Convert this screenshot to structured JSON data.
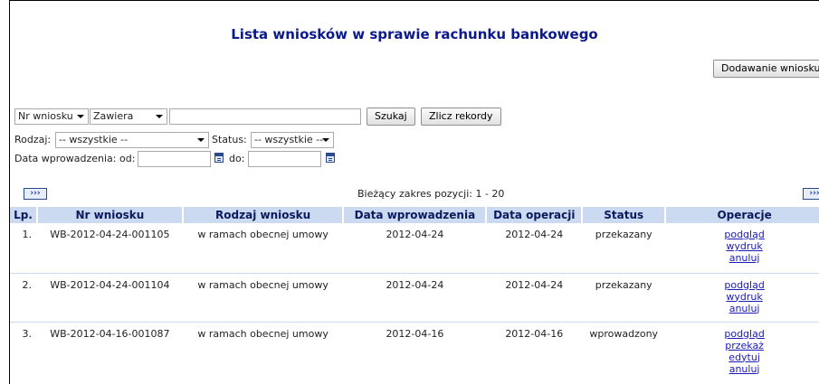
{
  "page": {
    "title": "Lista wniosków w sprawie rachunku bankowego",
    "add_button": "Dodawanie wniosku"
  },
  "filters": {
    "field_select": "Nr wniosku",
    "operator_select": "Zawiera",
    "search_value": "",
    "search_button": "Szukaj",
    "count_button": "Zlicz rekordy",
    "type_label": "Rodzaj:",
    "type_select": "-- wszystkie --",
    "status_label": "Status:",
    "status_select": "-- wszystkie --",
    "date_from_label": "Data wprowadzenia: od:",
    "date_from_value": "",
    "date_to_label": "do:",
    "date_to_value": ""
  },
  "pager": {
    "next_label": "›››",
    "range_text": "Bieżący zakres pozycji: 1 - 20"
  },
  "table": {
    "headers": [
      "Lp.",
      "Nr wniosku",
      "Rodzaj wniosku",
      "Data wprowadzenia",
      "Data operacji",
      "Status",
      "Operacje"
    ],
    "rows": [
      {
        "lp": "1.",
        "nr": "WB-2012-04-24-001105",
        "rodzaj": "w ramach obecnej umowy",
        "data_wpr": "2012-04-24",
        "data_op": "2012-04-24",
        "status": "przekazany",
        "ops": [
          "podgląd",
          "wydruk",
          "anuluj"
        ]
      },
      {
        "lp": "2.",
        "nr": "WB-2012-04-24-001104",
        "rodzaj": "w ramach obecnej umowy",
        "data_wpr": "2012-04-24",
        "data_op": "2012-04-24",
        "status": "przekazany",
        "ops": [
          "podgląd",
          "wydruk",
          "anuluj"
        ]
      },
      {
        "lp": "3.",
        "nr": "WB-2012-04-16-001087",
        "rodzaj": "w ramach obecnej umowy",
        "data_wpr": "2012-04-16",
        "data_op": "2012-04-16",
        "status": "wprowadzony",
        "ops": [
          "podgląd",
          "przekaż",
          "edytuj",
          "anuluj"
        ]
      }
    ]
  },
  "icons": {
    "calendar": "calendar-icon",
    "pager_next": "next-page-icon",
    "dropdown": "chevron-down-icon"
  },
  "colors": {
    "title": "#0a1a8c",
    "header_bg": "#cbdaf0",
    "link": "#1a1ab8"
  }
}
